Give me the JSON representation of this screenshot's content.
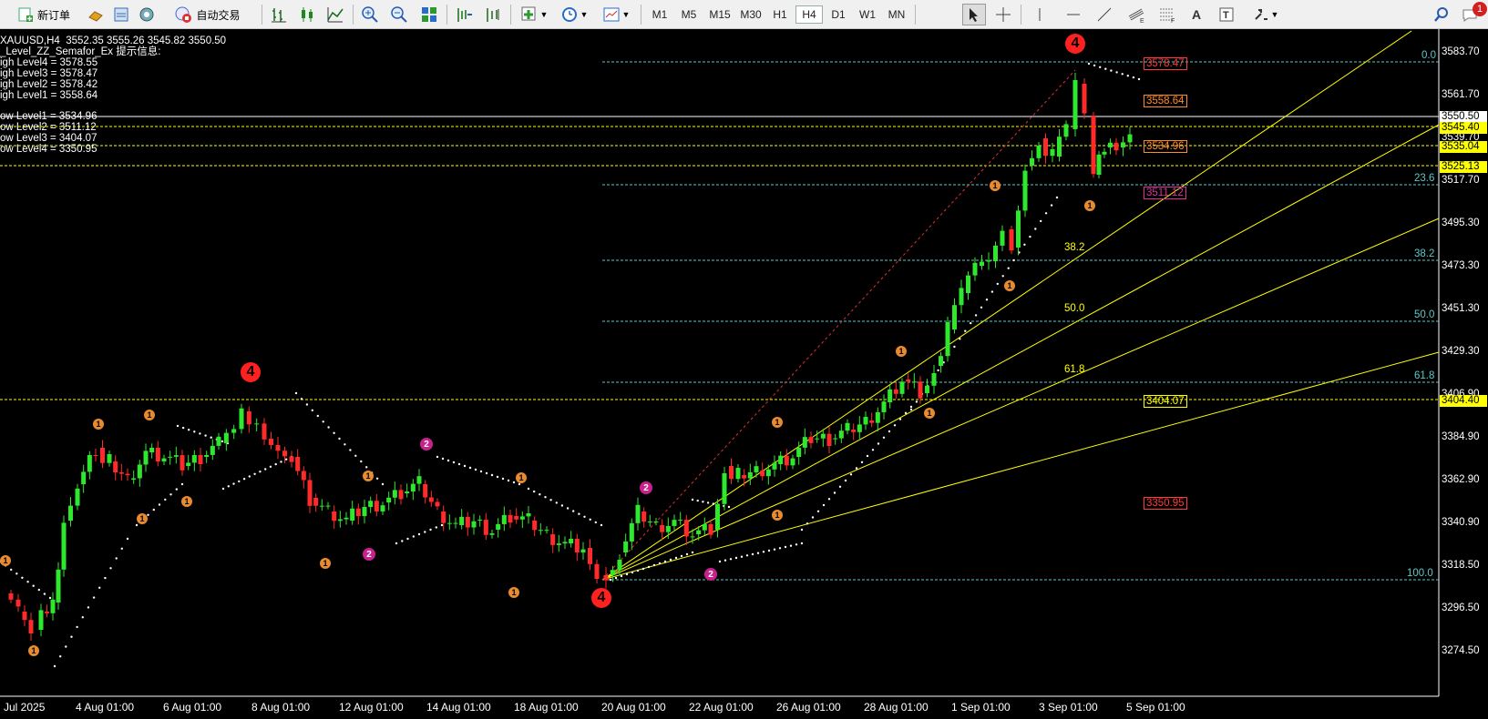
{
  "toolbar": {
    "new_order": "新订单",
    "auto_trading": "自动交易",
    "periods": [
      "M1",
      "M5",
      "M15",
      "M30",
      "H1",
      "H4",
      "D1",
      "W1",
      "MN"
    ],
    "active_period": "H4",
    "notification_count": "1"
  },
  "chart": {
    "header": "XAUUSD,H4  3552.35 3555.26 3545.82 3550.50",
    "indicator": "_Level_ZZ_Semafor_Ex 提示信息:",
    "high_levels": [
      "igh Level4 = 3578.55",
      "igh Level3 = 3578.47",
      "igh Level2 = 3578.42",
      "igh Level1 = 3558.64"
    ],
    "low_levels": [
      "ow Level1 = 3534.96",
      "ow Level2 = 3511.12",
      "ow Level3 = 3404.07",
      "ow Level4 = 3350.95"
    ],
    "price_axis": [
      "3583.70",
      "3561.70",
      "3539.70",
      "3517.70",
      "3495.30",
      "3473.30",
      "3451.30",
      "3429.30",
      "3406.90",
      "3384.90",
      "3362.90",
      "3340.90",
      "3318.50",
      "3296.50",
      "3274.50"
    ],
    "price_tags": [
      {
        "text": "3550.50",
        "color": "#ffffff"
      },
      {
        "text": "3545.40",
        "color": "#ffff00"
      },
      {
        "text": "3535.04",
        "color": "#ffff00"
      },
      {
        "text": "3525.13",
        "color": "#ffff00"
      },
      {
        "text": "3404.40",
        "color": "#ffff00"
      }
    ],
    "time_axis": [
      "Jul 2025",
      "4 Aug 01:00",
      "6 Aug 01:00",
      "8 Aug 01:00",
      "12 Aug 01:00",
      "14 Aug 01:00",
      "18 Aug 01:00",
      "20 Aug 01:00",
      "22 Aug 01:00",
      "26 Aug 01:00",
      "28 Aug 01:00",
      "1 Sep 01:00",
      "3 Sep 01:00",
      "5 Sep 01:00"
    ],
    "fib_right": [
      "0.0",
      "23.6",
      "38.2",
      "50.0",
      "61.8",
      "100.0"
    ],
    "fan_labels": [
      "38.2",
      "50.0",
      "61.8"
    ],
    "level_boxes": [
      {
        "text": "3578.47",
        "color": "#ff3b3b"
      },
      {
        "text": "3558.64",
        "color": "#ff8c2a"
      },
      {
        "text": "3534.96",
        "color": "#ff8c2a"
      },
      {
        "text": "3511.12",
        "color": "#e0309e"
      },
      {
        "text": "3404.07",
        "color": "#ffff00"
      },
      {
        "text": "3350.95",
        "color": "#ff3b3b"
      }
    ],
    "semafor_labels": {
      "small": "1",
      "mid": "2",
      "big": "4"
    }
  }
}
